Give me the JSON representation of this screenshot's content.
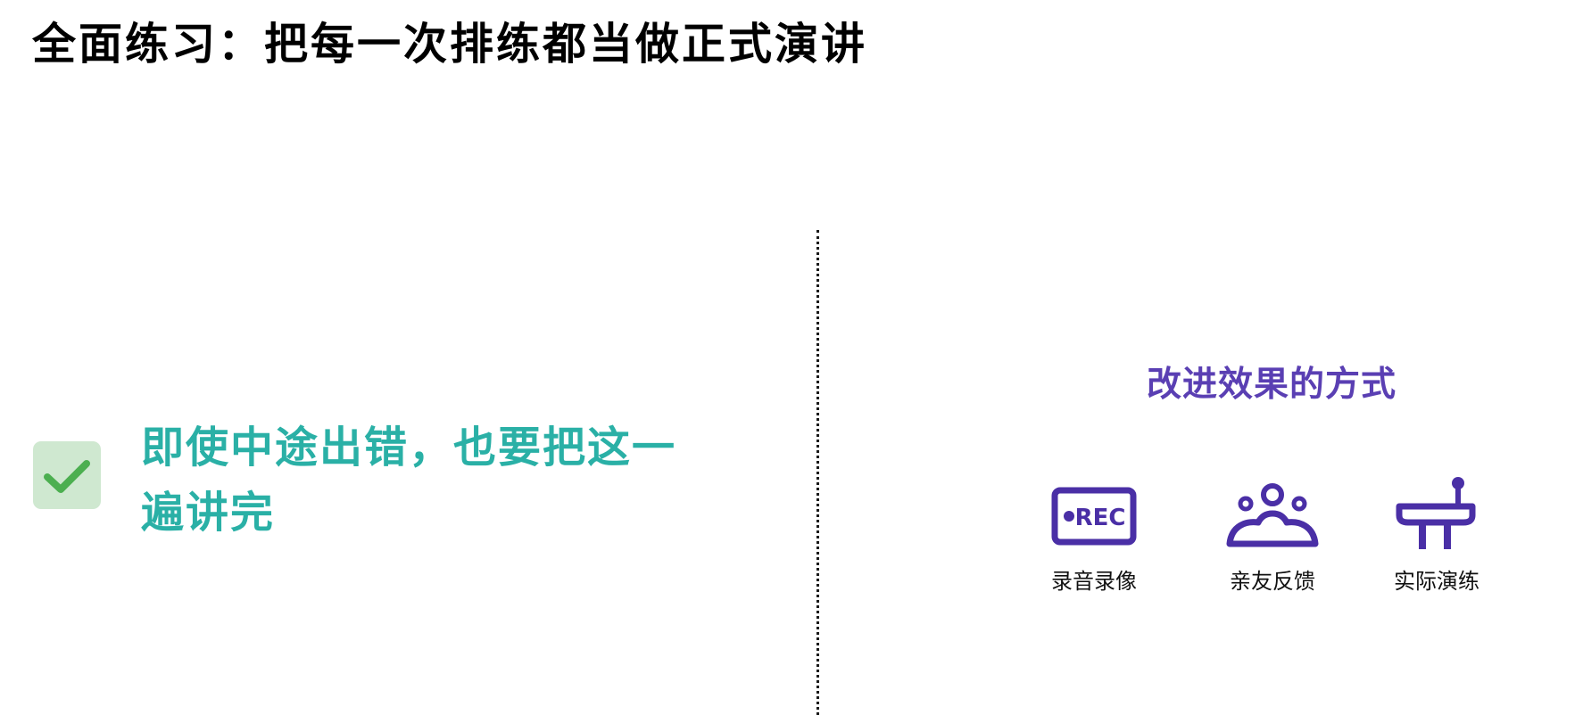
{
  "title": "全面练习：把每一次排练都当做正式演讲",
  "tip": {
    "icon": "check-icon",
    "text": "即使中途出错，也要把这一遍讲完"
  },
  "methods": {
    "title": "改进效果的方式",
    "items": [
      {
        "label": "录音录像",
        "icon": "rec-icon"
      },
      {
        "label": "亲友反馈",
        "icon": "audience-icon"
      },
      {
        "label": "实际演练",
        "icon": "podium-icon"
      }
    ]
  },
  "colors": {
    "tip_text": "#2ab0a6",
    "check_bg": "#cfe8d0",
    "check_mark": "#4caf50",
    "accent": "#5a3fb3",
    "icon": "#4a2fa6"
  }
}
